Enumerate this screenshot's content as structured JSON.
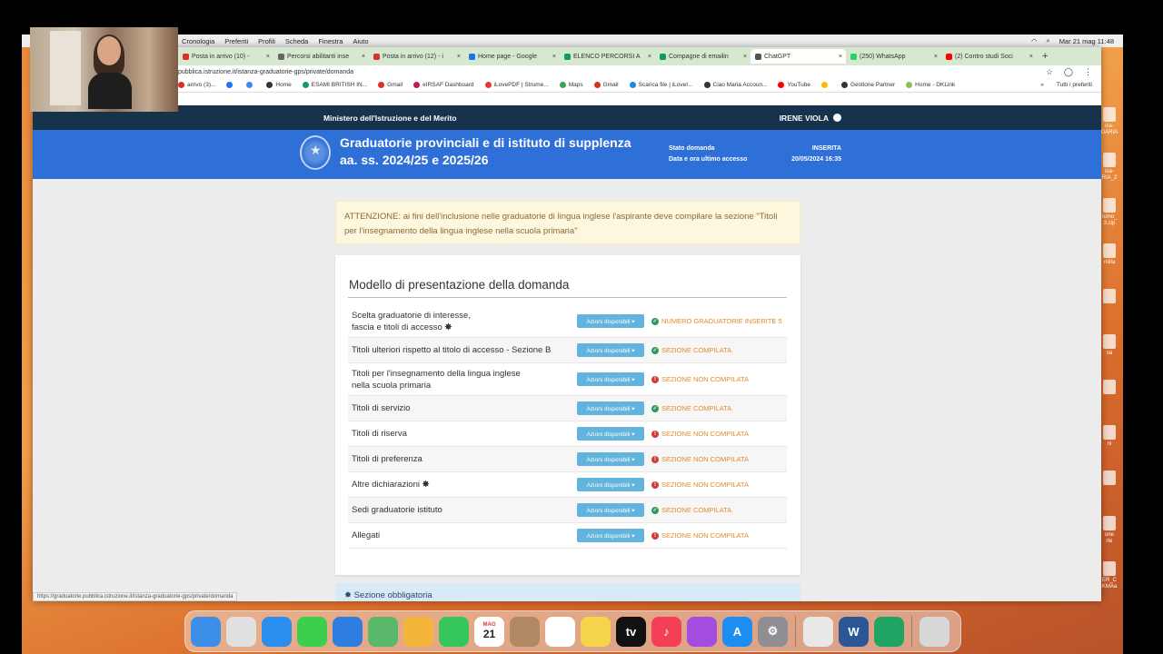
{
  "menubar": {
    "items": [
      "Cronologia",
      "Preferiti",
      "Profili",
      "Scheda",
      "Finestra",
      "Aiuto"
    ],
    "clock": "Mar 21 mag  11:48"
  },
  "tabs": [
    {
      "label": "Posta in arrivo (10) - ",
      "color": "#d93025"
    },
    {
      "label": "Percorsi abilitanti inse",
      "color": "#666"
    },
    {
      "label": "Posta in arrivo (12) - i",
      "color": "#d93025"
    },
    {
      "label": "Home page - Google",
      "color": "#1a73e8"
    },
    {
      "label": "ELENCO PERCORSI A",
      "color": "#0f9d58"
    },
    {
      "label": "Compagne di emailin",
      "color": "#0f9d58"
    },
    {
      "label": "ChatGPT",
      "color": "#555",
      "active": true
    },
    {
      "label": "(250) WhatsApp",
      "color": "#25d366"
    },
    {
      "label": "(2) Contro studi Soci",
      "color": "#ff0000"
    }
  ],
  "address": {
    "url": "pubblica.istruzione.it/istanza-graduatorie-gps/private/domanda"
  },
  "bookmarks": [
    {
      "label": "arrivo (3)...",
      "color": "#d93025"
    },
    {
      "label": "",
      "color": "#1877f2"
    },
    {
      "label": "",
      "color": "#4285f4"
    },
    {
      "label": "Home",
      "color": "#333"
    },
    {
      "label": "ESAMI BRITISH IN...",
      "color": "#0f9d58"
    },
    {
      "label": "Gmail",
      "color": "#d93025"
    },
    {
      "label": "eIRSAF Dashboard",
      "color": "#c2185b"
    },
    {
      "label": "iLovePDF | Strume...",
      "color": "#e53935"
    },
    {
      "label": "Maps",
      "color": "#34a853"
    },
    {
      "label": "Gmail",
      "color": "#d93025"
    },
    {
      "label": "Scarica file | iLoveI...",
      "color": "#1e88e5"
    },
    {
      "label": "Ciao Maria Accoun...",
      "color": "#333"
    },
    {
      "label": "YouTube",
      "color": "#ff0000"
    },
    {
      "label": "",
      "color": "#fbbc05"
    },
    {
      "label": "Gestione Partner",
      "color": "#333"
    },
    {
      "label": "Home - DKLink",
      "color": "#8bc34a"
    }
  ],
  "bookmarks_all": "Tutti i preferiti",
  "site": {
    "ministry": "Ministero dell'Istruzione e del Merito",
    "user": "IRENE VIOLA",
    "title_line1": "Graduatorie provinciali e di istituto di supplenza",
    "title_line2": "aa. ss. 2024/25 e 2025/26",
    "stato_label": "Stato domanda",
    "stato_value": "INSERITA",
    "accesso_label": "Data e ora ultimo accesso",
    "accesso_value": "20/05/2024 16:35"
  },
  "alert": {
    "text": "ATTENZIONE: ai fini dell'inclusione nelle graduatorie di lingua inglese l'aspirante deve compilare la sezione \"Titoli per l'insegnamento della lingua inglese nella scuola primaria\""
  },
  "card": {
    "title": "Modello di presentazione della domanda",
    "button_label": "Azioni disponibili ▾",
    "rows": [
      {
        "label": "Scelta graduatorie di interesse,\nfascia e titoli di accesso",
        "star": true,
        "status": "NUMERO GRADUATORIE INSERITE 5",
        "ok": true
      },
      {
        "label": "Titoli ulteriori rispetto al titolo di accesso - Sezione B",
        "star": false,
        "status": "SEZIONE COMPILATA",
        "ok": true
      },
      {
        "label": "Titoli per l'insegnamento della lingua inglese\nnella scuola primaria",
        "star": false,
        "status": "SEZIONE NON COMPILATA",
        "ok": false
      },
      {
        "label": "Titoli di servizio",
        "star": false,
        "status": "SEZIONE COMPILATA",
        "ok": true
      },
      {
        "label": "Titoli di riserva",
        "star": false,
        "status": "SEZIONE NON COMPILATA",
        "ok": false
      },
      {
        "label": "Titoli di preferenza",
        "star": false,
        "status": "SEZIONE NON COMPILATA",
        "ok": false
      },
      {
        "label": "Altre dichiarazioni",
        "star": true,
        "status": "SEZIONE NON COMPILATA",
        "ok": false
      },
      {
        "label": "Sedi graduatorie istituto",
        "star": false,
        "status": "SEZIONE COMPILATA",
        "ok": true
      },
      {
        "label": "Allegati",
        "star": false,
        "status": "SEZIONE NON COMPILATA",
        "ok": false
      }
    ]
  },
  "footnote": "✸ Sezione obbligatoria",
  "status_url": "https://graduatorie.pubblica.istruzione.it/istanza-graduatorie-gps/private/domanda",
  "desktop_files": [
    "ica-\nDARIA",
    "ica-\nRIA_2",
    "rumo_\n3.zip",
    "milla",
    "",
    "na",
    "",
    "ni",
    "",
    "one\nrte",
    "ER_C\nKMAa"
  ],
  "dock": [
    {
      "name": "finder-icon",
      "color": "#3b8fe8",
      "glyph": ""
    },
    {
      "name": "launchpad-icon",
      "color": "#e0e0e0",
      "glyph": ""
    },
    {
      "name": "safari-icon",
      "color": "#2a8ef0",
      "glyph": ""
    },
    {
      "name": "messages-icon",
      "color": "#3ccf4e",
      "glyph": ""
    },
    {
      "name": "mail-icon",
      "color": "#2e7de1",
      "glyph": ""
    },
    {
      "name": "maps-icon",
      "color": "#59b86a",
      "glyph": ""
    },
    {
      "name": "photos-icon",
      "color": "#f4b63a",
      "glyph": ""
    },
    {
      "name": "facetime-icon",
      "color": "#35c759",
      "glyph": ""
    },
    {
      "name": "calendar-icon",
      "color": "#ffffff",
      "glyph": "21"
    },
    {
      "name": "contacts-icon",
      "color": "#b08a66",
      "glyph": ""
    },
    {
      "name": "reminders-icon",
      "color": "#ffffff",
      "glyph": ""
    },
    {
      "name": "notes-icon",
      "color": "#f7d54a",
      "glyph": ""
    },
    {
      "name": "tv-icon",
      "color": "#111111",
      "glyph": "tv"
    },
    {
      "name": "music-icon",
      "color": "#f43f57",
      "glyph": "♪"
    },
    {
      "name": "podcasts-icon",
      "color": "#a24ce0",
      "glyph": ""
    },
    {
      "name": "appstore-icon",
      "color": "#1c8ef2",
      "glyph": "A"
    },
    {
      "name": "settings-icon",
      "color": "#8e8e93",
      "glyph": "⚙"
    },
    {
      "name": "chrome-icon",
      "color": "#e8e8e8",
      "glyph": ""
    },
    {
      "name": "word-icon",
      "color": "#2b5797",
      "glyph": "W"
    },
    {
      "name": "app-icon",
      "color": "#1fa463",
      "glyph": ""
    },
    {
      "name": "trash-icon",
      "color": "#d8d8d8",
      "glyph": ""
    }
  ],
  "calendar_month": "MAG"
}
